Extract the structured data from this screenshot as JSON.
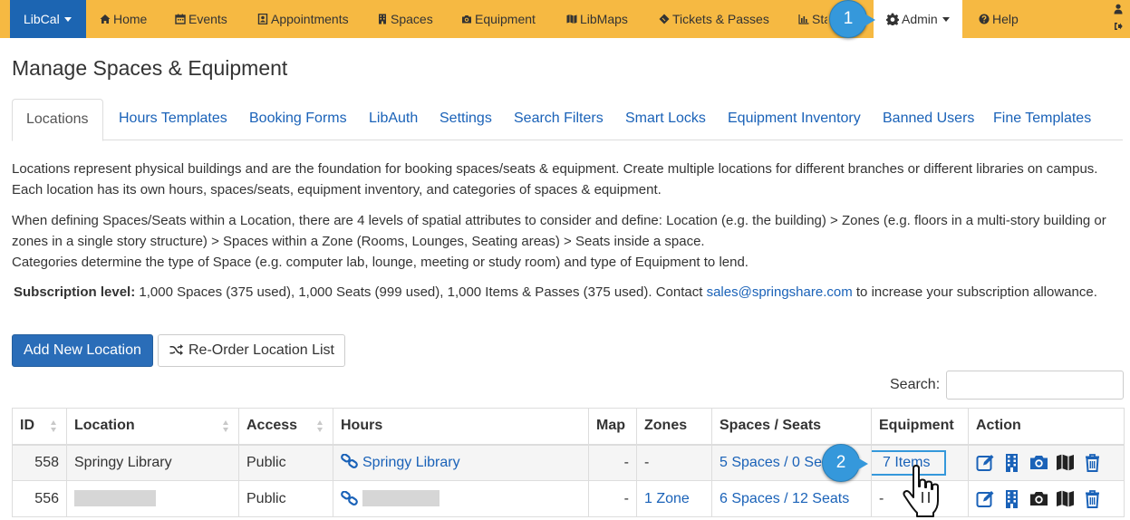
{
  "navbar": {
    "brand": "LibCal",
    "items": [
      {
        "label": "Home"
      },
      {
        "label": "Events"
      },
      {
        "label": "Appointments"
      },
      {
        "label": "Spaces"
      },
      {
        "label": "Equipment"
      },
      {
        "label": "LibMaps"
      },
      {
        "label": "Tickets & Passes"
      },
      {
        "label": "Stats"
      },
      {
        "label": "Admin"
      },
      {
        "label": "Help"
      }
    ]
  },
  "callouts": {
    "one": "1",
    "two": "2"
  },
  "page": {
    "title": "Manage Spaces & Equipment"
  },
  "tabs": [
    {
      "label": "Locations",
      "active": true
    },
    {
      "label": "Hours Templates"
    },
    {
      "label": "Booking Forms"
    },
    {
      "label": "LibAuth"
    },
    {
      "label": "Settings"
    },
    {
      "label": "Search Filters"
    },
    {
      "label": "Smart Locks"
    },
    {
      "label": "Equipment Inventory"
    },
    {
      "label": "Banned Users"
    },
    {
      "label": "Fine Templates"
    }
  ],
  "intro": {
    "p1": "Locations represent physical buildings and are the foundation for booking spaces/seats & equipment. Create multiple locations for different branches or different libraries on campus. Each location has its own hours, spaces/seats, equipment inventory, and categories of spaces & equipment.",
    "p2": "When defining Spaces/Seats within a Location, there are 4 levels of spatial attributes to consider and define: Location (e.g. the building) > Zones (e.g. floors in a multi-story building or zones in a single story structure) > Spaces within a Zone (Rooms, Lounges, Seating areas) > Seats inside a space.",
    "p3": "Categories determine the type of Space (e.g. computer lab, lounge, meeting or study room) and type of Equipment to lend."
  },
  "subscription": {
    "label": "Subscription level:",
    "text": " 1,000 Spaces (375 used), 1,000 Seats (999 used), 1,000 Items & Passes (375 used). Contact ",
    "email": "sales@springshare.com",
    "suffix": " to increase your subscription allowance."
  },
  "buttons": {
    "add": "Add New Location",
    "reorder": "Re-Order Location List"
  },
  "search": {
    "label": "Search:",
    "value": ""
  },
  "table": {
    "headers": [
      "ID",
      "Location",
      "Access",
      "Hours",
      "Map",
      "Zones",
      "Spaces / Seats",
      "Equipment",
      "Action"
    ],
    "rows": [
      {
        "id": "558",
        "location": "Springy Library",
        "access": "Public",
        "hours": "Springy Library",
        "map": "-",
        "zones": "-",
        "spaces": "5 Spaces / 0 Seats",
        "equipment": "7 Items"
      },
      {
        "id": "556",
        "location": "",
        "access": "Public",
        "hours": "",
        "map": "-",
        "zones": "1 Zone",
        "spaces": "6 Spaces / 12 Seats",
        "equipment": "-"
      }
    ]
  },
  "colors": {
    "navbar": "#f6b942",
    "brand": "#1c65b2",
    "link": "#1a62b8",
    "callout": "#3598db"
  },
  "icons": [
    "home-icon",
    "calendar-icon",
    "contact-card-icon",
    "building-icon",
    "camera-icon",
    "map-icon",
    "ticket-icon",
    "bar-chart-icon",
    "gear-icon",
    "question-circle-icon",
    "user-icon",
    "logout-icon",
    "shuffle-icon",
    "link-icon",
    "edit-icon",
    "hand-pointer-icon"
  ]
}
